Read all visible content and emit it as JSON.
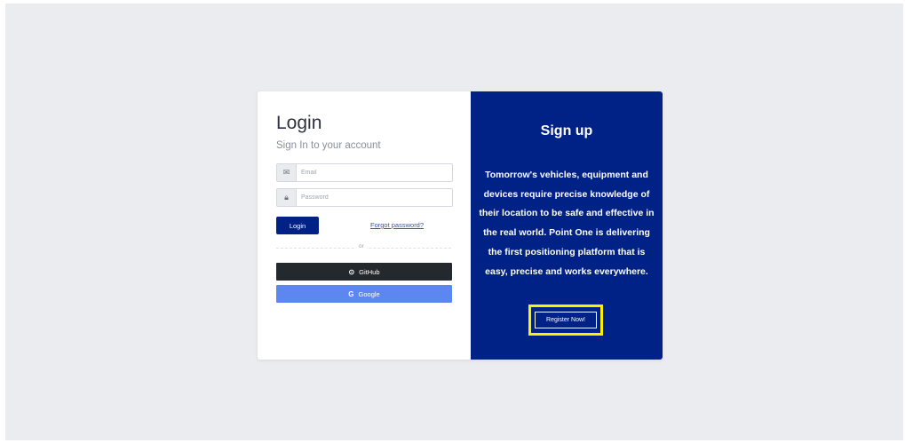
{
  "login": {
    "title": "Login",
    "subtitle": "Sign In to your account",
    "email_placeholder": "Email",
    "password_placeholder": "Password",
    "login_button": "Login",
    "forgot_password": "Forgot password?",
    "divider_text": "or",
    "github_button": "GitHub",
    "google_button": "Google"
  },
  "signup": {
    "title": "Sign up",
    "text": "Tomorrow's vehicles, equipment and devices require precise knowledge of their location to be safe and effective in the real world. Point One is delivering the first positioning platform that is easy, precise and works everywhere.",
    "register_button": "Register Now!"
  },
  "colors": {
    "primary": "#002185",
    "highlight": "#ffef00",
    "github": "#24292e",
    "google": "#5c87ee"
  }
}
